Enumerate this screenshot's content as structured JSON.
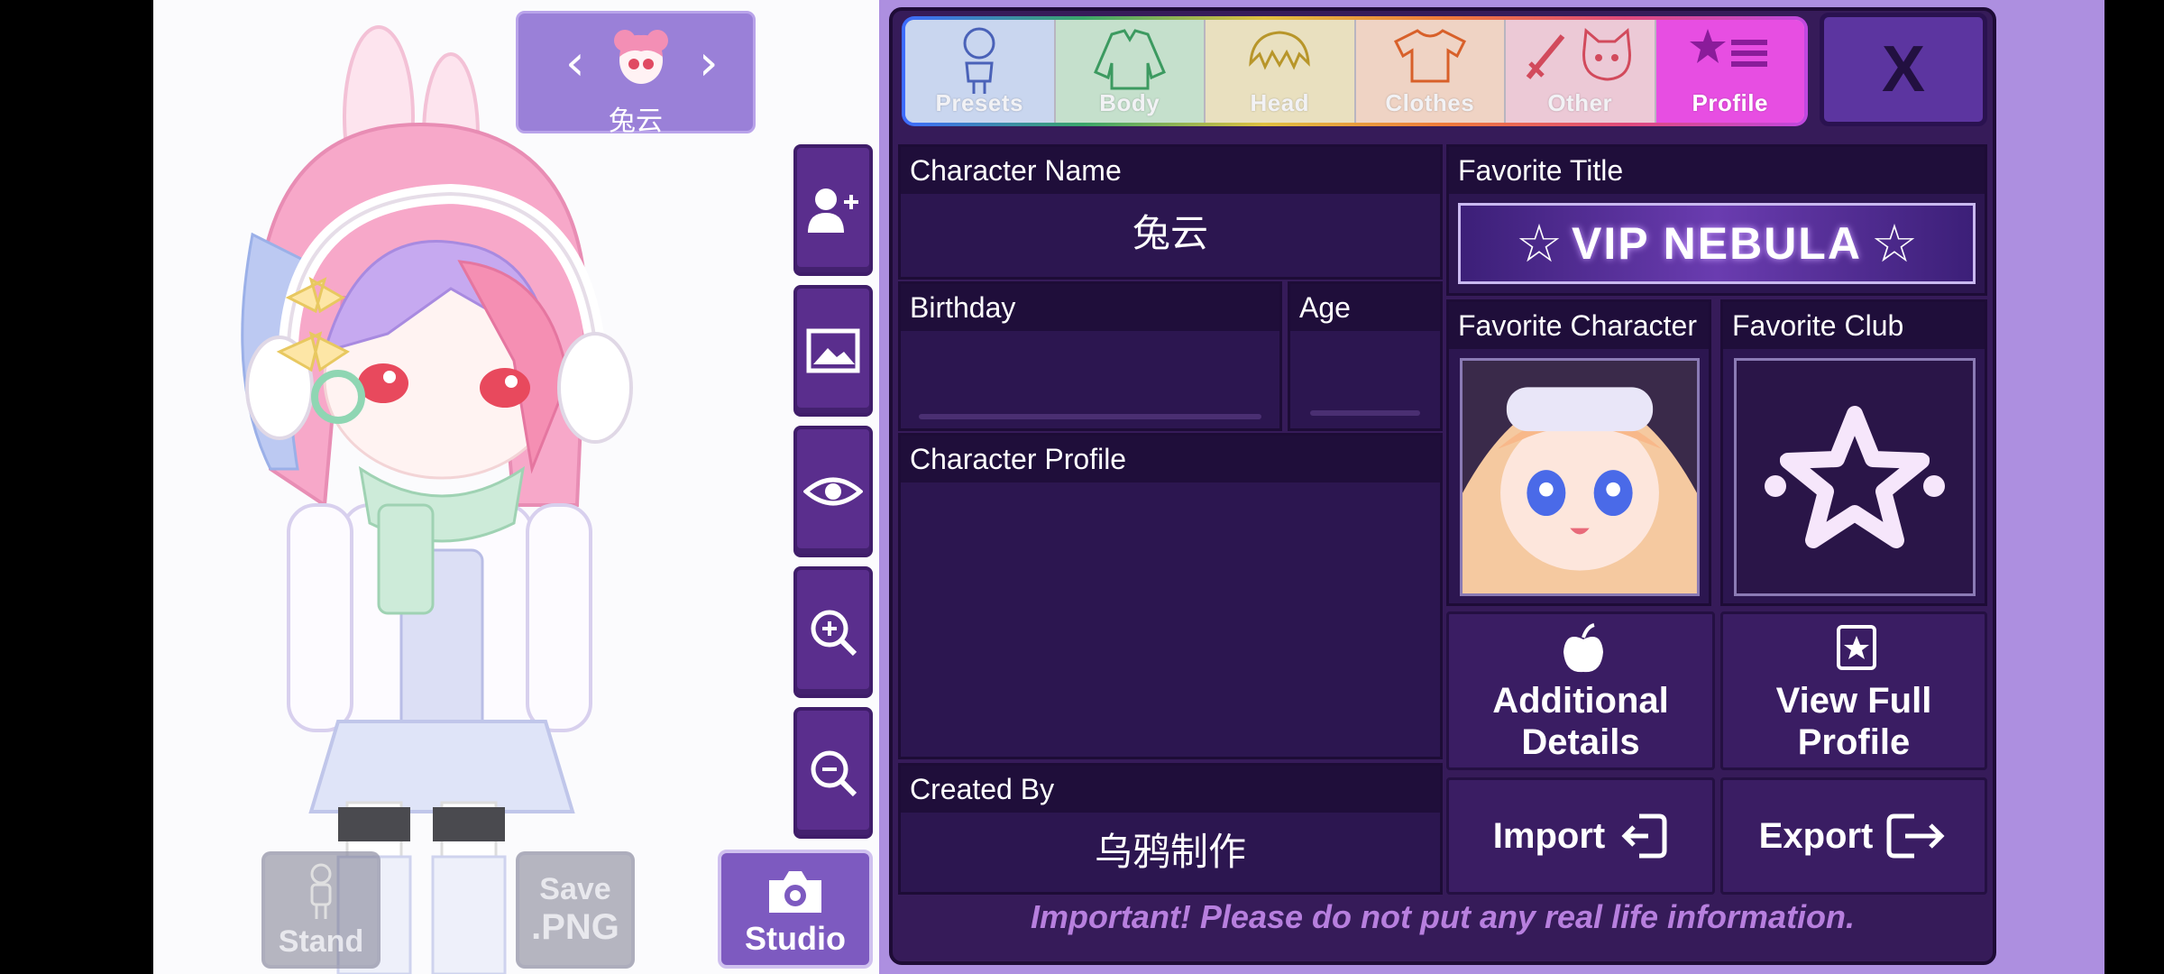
{
  "character_selector": {
    "name": "兔云",
    "prev_arrow": "‹",
    "next_arrow": "›"
  },
  "side_tools": [
    {
      "name": "add-character-icon"
    },
    {
      "name": "background-image-icon"
    },
    {
      "name": "visibility-eye-icon"
    },
    {
      "name": "zoom-in-icon"
    },
    {
      "name": "zoom-out-icon"
    }
  ],
  "bottom_buttons": {
    "stand": "Stand",
    "save_png_line1": "Save",
    "save_png_line2": ".PNG",
    "studio": "Studio"
  },
  "tabs": [
    {
      "label": "Presets",
      "icon": "presets-figure-icon"
    },
    {
      "label": "Body",
      "icon": "body-jacket-icon"
    },
    {
      "label": "Head",
      "icon": "head-hair-icon"
    },
    {
      "label": "Clothes",
      "icon": "clothes-shirt-icon"
    },
    {
      "label": "Other",
      "icon": "other-sword-cat-icon"
    },
    {
      "label": "Profile",
      "icon": "profile-star-icon"
    }
  ],
  "close_label": "X",
  "profile": {
    "character_name_label": "Character Name",
    "character_name_value": "兔云",
    "birthday_label": "Birthday",
    "birthday_value": "",
    "age_label": "Age",
    "age_value": "",
    "character_profile_label": "Character Profile",
    "created_by_label": "Created By",
    "created_by_value": "乌鸦制作",
    "favorite_title_label": "Favorite Title",
    "favorite_title_value": "VIP NEBULA",
    "favorite_character_label": "Favorite Character",
    "favorite_club_label": "Favorite Club",
    "additional_details_line1": "Additional",
    "additional_details_line2": "Details",
    "view_full_line1": "View Full",
    "view_full_line2": "Profile",
    "import_label": "Import",
    "export_label": "Export"
  },
  "notice": "Important! Please do not put any real life information.",
  "colors": {
    "panel": "#361b59",
    "profile_tab": "#e74ee2",
    "accent_bg": "#ad8fe0"
  }
}
